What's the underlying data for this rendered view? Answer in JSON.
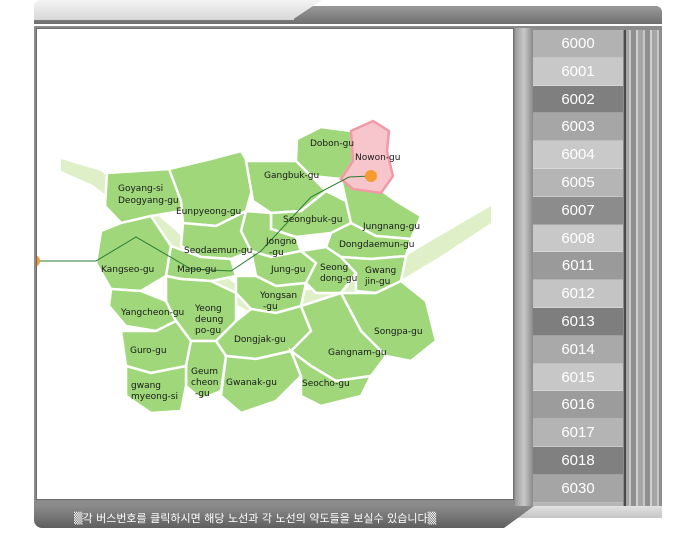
{
  "routes": [
    "6000",
    "6001",
    "6002",
    "6003",
    "6004",
    "6005",
    "6007",
    "6008",
    "6011",
    "6012",
    "6013",
    "6014",
    "6015",
    "6016",
    "6017",
    "6018",
    "6030"
  ],
  "route_colors": [
    "#b2b2b2",
    "#c8c8c8",
    "#7f7f7f",
    "#a6a6a6",
    "#c9c9c9",
    "#b5b5b5",
    "#8c8c8c",
    "#c8c8c8",
    "#9a9a9a",
    "#c4c4c4",
    "#7e7e7e",
    "#a9a9a9",
    "#c7c7c7",
    "#9c9c9c",
    "#b4b4b4",
    "#808080",
    "#a5a5a5"
  ],
  "map": {
    "districts": [
      "Dobon-gu",
      "Nowon-gu",
      "Gangbuk-gu",
      "Goyang-si Deogyang-gu",
      "Eunpyeong-gu",
      "Seongbuk-gu",
      "Jungnang-gu",
      "Jongno -gu",
      "Dongdaemun-gu",
      "Seodaemun-gu",
      "Kangseo-gu",
      "Mapo-gu",
      "Jung-gu",
      "Seong dong-gu",
      "Gwang jin-gu",
      "Yongsan -gu",
      "Yangcheon-gu",
      "Yeong deung po-gu",
      "Songpa-gu",
      "Guro-gu",
      "Dongjak-gu",
      "Gangnam-gu",
      "Geum cheon -gu",
      "Gwanak-gu",
      "Seocho-gu",
      "gwang myeong-si"
    ],
    "highlight": "Nowon-gu",
    "highlight_color": "#f6c6cc",
    "district_color": "#9fd77a",
    "marker_color": "#f59a2c"
  },
  "footer": {
    "hint": "▒각 버스번호를 클릭하시면 해당 노선과 각 노선의 약도들을 보실수 있습니다▒"
  }
}
